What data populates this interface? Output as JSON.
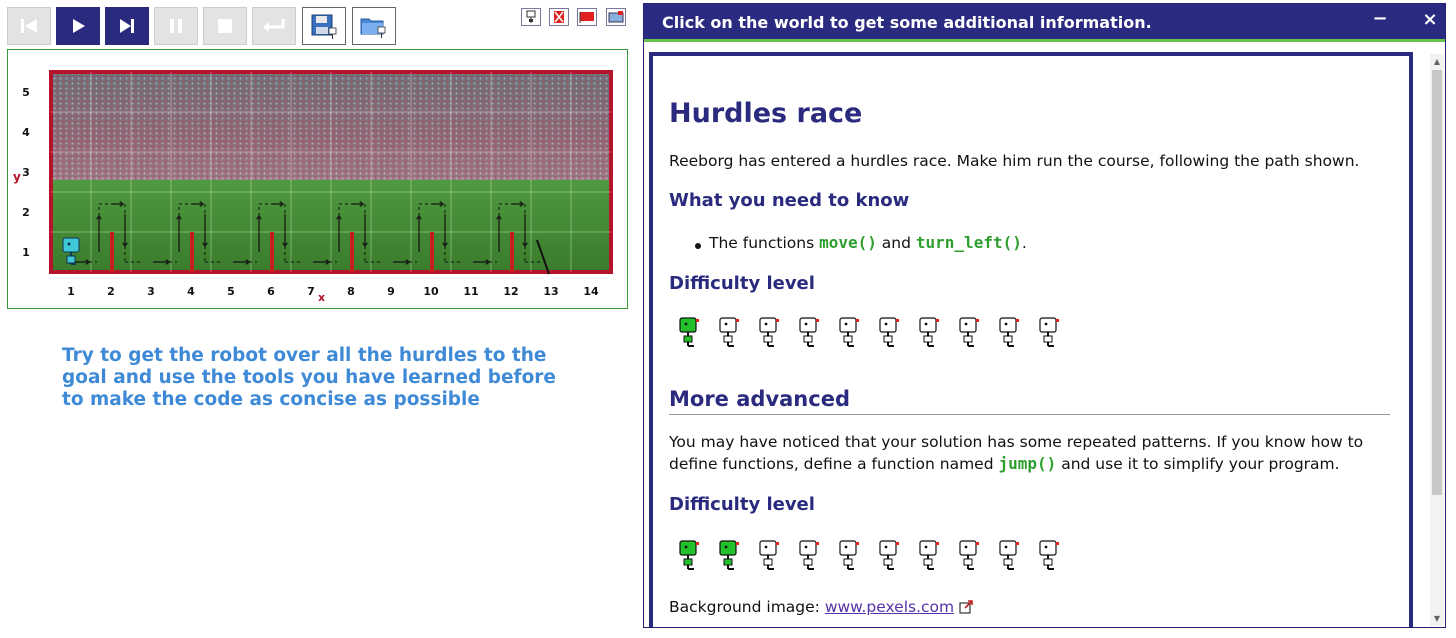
{
  "toolbar": {
    "buttons": [
      {
        "name": "reload-button",
        "icon": "skip-back-icon"
      },
      {
        "name": "run-button",
        "icon": "play-icon"
      },
      {
        "name": "step-button",
        "icon": "step-forward-icon"
      },
      {
        "name": "pause-button",
        "icon": "pause-icon"
      },
      {
        "name": "stop-button",
        "icon": "stop-icon"
      },
      {
        "name": "return-button",
        "icon": "return-icon"
      },
      {
        "name": "save-world-button",
        "icon": "floppy-robot-icon"
      },
      {
        "name": "open-world-button",
        "icon": "folder-robot-icon"
      }
    ],
    "mini_buttons": [
      "robot-mini-icon",
      "red-x-icon",
      "red-flag-icon",
      "edit-world-icon"
    ]
  },
  "world": {
    "y_axis_label": "y",
    "x_axis_label": "x",
    "y_ticks": [
      "1",
      "2",
      "3",
      "4",
      "5"
    ],
    "x_ticks": [
      "1",
      "2",
      "3",
      "4",
      "5",
      "6",
      "7",
      "8",
      "9",
      "10",
      "11",
      "12",
      "13",
      "14"
    ],
    "hurdles_at_x": [
      2,
      4,
      6,
      8,
      10,
      12
    ],
    "goal_x": 13,
    "colors": {
      "border": "#b5122b",
      "field": "#3e8a2e",
      "hurdle": "#c41e1e"
    }
  },
  "task_text": "Try to get the robot over all the hurdles to the goal and use the tools you have learned before to make the code as concise as possible",
  "dialog": {
    "title": "Click on the world to get some additional information.",
    "minimize_glyph": "−",
    "close_glyph": "×",
    "heading": "Hurdles race",
    "intro": "Reeborg has entered a hurdles race. Make him run the course, following the path shown.",
    "need_heading": "What you need to know",
    "bullet_prefix": "The functions ",
    "bullet_code1": "move()",
    "bullet_mid": " and ",
    "bullet_code2": "turn_left()",
    "bullet_end": ".",
    "difficulty_heading_1": "Difficulty level",
    "difficulty_1": {
      "filled": 1,
      "total": 10
    },
    "advanced_heading": "More advanced",
    "advanced_line1": "You may have noticed that your solution has some repeated patterns. If you know how to",
    "advanced_line2_a": "define functions, define a function named ",
    "advanced_line2_code": "jump()",
    "advanced_line2_b": " and use it to simplify your program.",
    "difficulty_heading_2": "Difficulty level",
    "difficulty_2": {
      "filled": 2,
      "total": 10
    },
    "bg_label": "Background image: ",
    "bg_link": "www.pexels.com",
    "colors": {
      "title_bg": "#2a2a80",
      "accent": "#6ac24a",
      "heading": "#2a2a7e",
      "code": "#2e9e2e"
    }
  }
}
